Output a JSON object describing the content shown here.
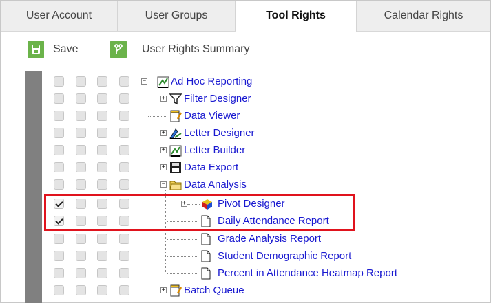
{
  "tabs": [
    {
      "label": "User Account",
      "active": false
    },
    {
      "label": "User Groups",
      "active": false
    },
    {
      "label": "Tool Rights",
      "active": true
    },
    {
      "label": "Calendar Rights",
      "active": false
    }
  ],
  "toolbar": {
    "save_label": "Save",
    "summary_label": "User Rights Summary"
  },
  "colors": {
    "accent_green": "#6bb34a",
    "link_blue": "#1a1ad0",
    "highlight_red": "#e0131d"
  },
  "tree": [
    {
      "label": "Ad Hoc Reporting",
      "icon": "report-icon",
      "checked": false
    },
    {
      "label": "Filter Designer",
      "icon": "filter-icon",
      "checked": false
    },
    {
      "label": "Data Viewer",
      "icon": "data-viewer-icon",
      "checked": false
    },
    {
      "label": "Letter Designer",
      "icon": "letter-designer-icon",
      "checked": false
    },
    {
      "label": "Letter Builder",
      "icon": "letter-builder-icon",
      "checked": false
    },
    {
      "label": "Data Export",
      "icon": "floppy-disk-icon",
      "checked": false
    },
    {
      "label": "Data Analysis",
      "icon": "folder-icon",
      "checked": false
    },
    {
      "label": "Pivot Designer",
      "icon": "pivot-cube-icon",
      "checked": true
    },
    {
      "label": "Daily Attendance Report",
      "icon": "document-icon",
      "checked": true
    },
    {
      "label": "Grade Analysis Report",
      "icon": "document-icon",
      "checked": false
    },
    {
      "label": "Student Demographic Report",
      "icon": "document-icon",
      "checked": false
    },
    {
      "label": "Percent in Attendance Heatmap Report",
      "icon": "document-icon",
      "checked": false
    },
    {
      "label": "Batch Queue",
      "icon": "batch-queue-icon",
      "checked": false
    }
  ]
}
